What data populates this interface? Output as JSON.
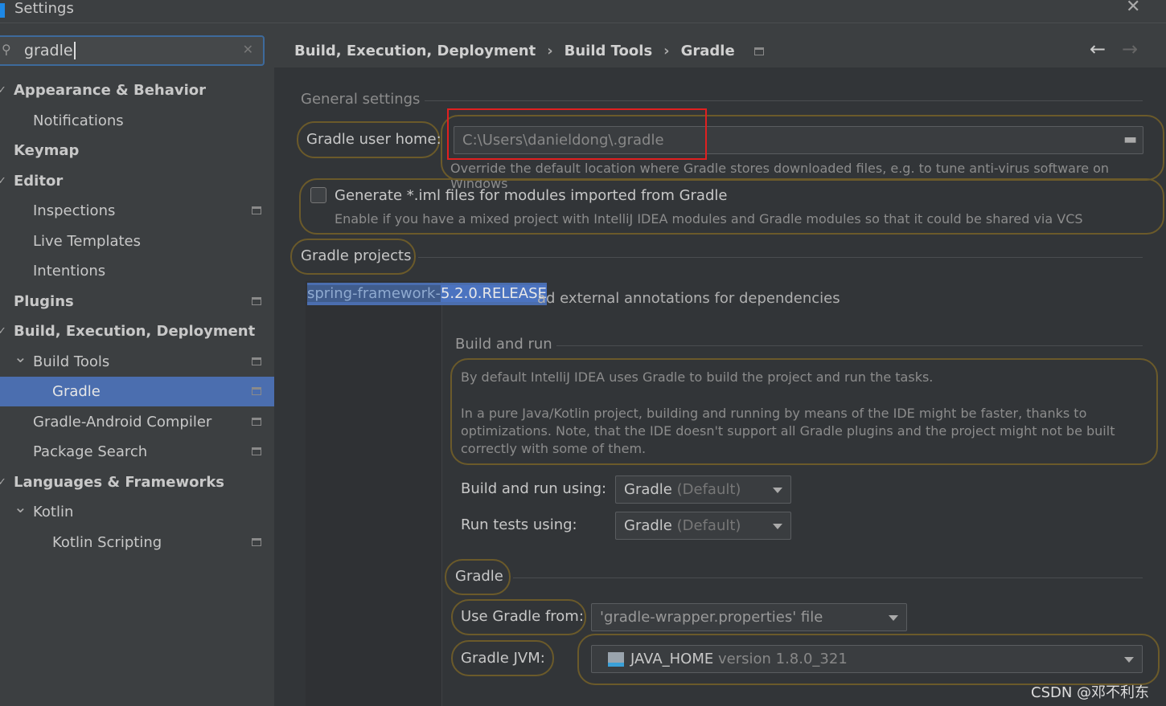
{
  "window": {
    "title": "Settings"
  },
  "search": {
    "value": "gradle"
  },
  "sidebar": {
    "items": [
      {
        "label": "Appearance & Behavior",
        "bold": true,
        "level": 0,
        "expanded": true
      },
      {
        "label": "Notifications",
        "level": 1
      },
      {
        "label": "Keymap",
        "bold": true,
        "level": 0
      },
      {
        "label": "Editor",
        "bold": true,
        "level": 0,
        "expanded": true
      },
      {
        "label": "Inspections",
        "level": 1,
        "pin": true
      },
      {
        "label": "Live Templates",
        "level": 1
      },
      {
        "label": "Intentions",
        "level": 1
      },
      {
        "label": "Plugins",
        "bold": true,
        "level": 0,
        "pin": true
      },
      {
        "label": "Build, Execution, Deployment",
        "bold": true,
        "level": 0,
        "expanded": true
      },
      {
        "label": "Build Tools",
        "level": 1,
        "pin": true,
        "chevron": true
      },
      {
        "label": "Gradle",
        "level": 2,
        "pin": true,
        "selected": true
      },
      {
        "label": "Gradle-Android Compiler",
        "level": 1,
        "pin": true
      },
      {
        "label": "Package Search",
        "level": 1,
        "pin": true
      },
      {
        "label": "Languages & Frameworks",
        "bold": true,
        "level": 0,
        "expanded": true
      },
      {
        "label": "Kotlin",
        "level": 1,
        "chevron": true
      },
      {
        "label": "Kotlin Scripting",
        "level": 2,
        "pin": true
      }
    ]
  },
  "breadcrumb": [
    "Build, Execution, Deployment",
    "Build Tools",
    "Gradle"
  ],
  "general": {
    "title": "General settings",
    "home_label": "Gradle user home:",
    "home_value": "C:\\Users\\danieldong\\.gradle",
    "home_hint": "Override the default location where Gradle stores downloaded files, e.g. to tune anti-virus software on Windows",
    "iml_label": "Generate *.iml files for modules imported from Gradle",
    "iml_hint": "Enable if you have a mixed project with IntelliJ IDEA modules and Gradle modules so that it could be shared via VCS"
  },
  "projects": {
    "title": "Gradle projects",
    "project_prefix": "spring-framework-",
    "project_version": "5.2.0.RELEASE",
    "annotations": "ad external annotations for dependencies"
  },
  "build_run": {
    "title": "Build and run",
    "info1": "By default IntelliJ IDEA uses Gradle to build the project and run the tasks.",
    "info2": "In a pure Java/Kotlin project, building and running by means of the IDE might be faster, thanks to optimizations. Note, that the IDE doesn't support all Gradle plugins and the project might not be built correctly with some of them.",
    "using_label": "Build and run using:",
    "using_value": "Gradle",
    "using_default": "(Default)",
    "tests_label": "Run tests using:",
    "tests_value": "Gradle",
    "tests_default": "(Default)"
  },
  "gradle": {
    "title": "Gradle",
    "from_label": "Use Gradle from:",
    "from_value": "'gradle-wrapper.properties' file",
    "jvm_label": "Gradle JVM:",
    "jvm_value": "JAVA_HOME",
    "jvm_version": "version 1.8.0_321"
  },
  "watermark": "CSDN @邓不利东",
  "colors": {
    "selection": "#4b6eaf",
    "highlight_ring": "#6b5a2a",
    "red_box": "#e02020"
  }
}
